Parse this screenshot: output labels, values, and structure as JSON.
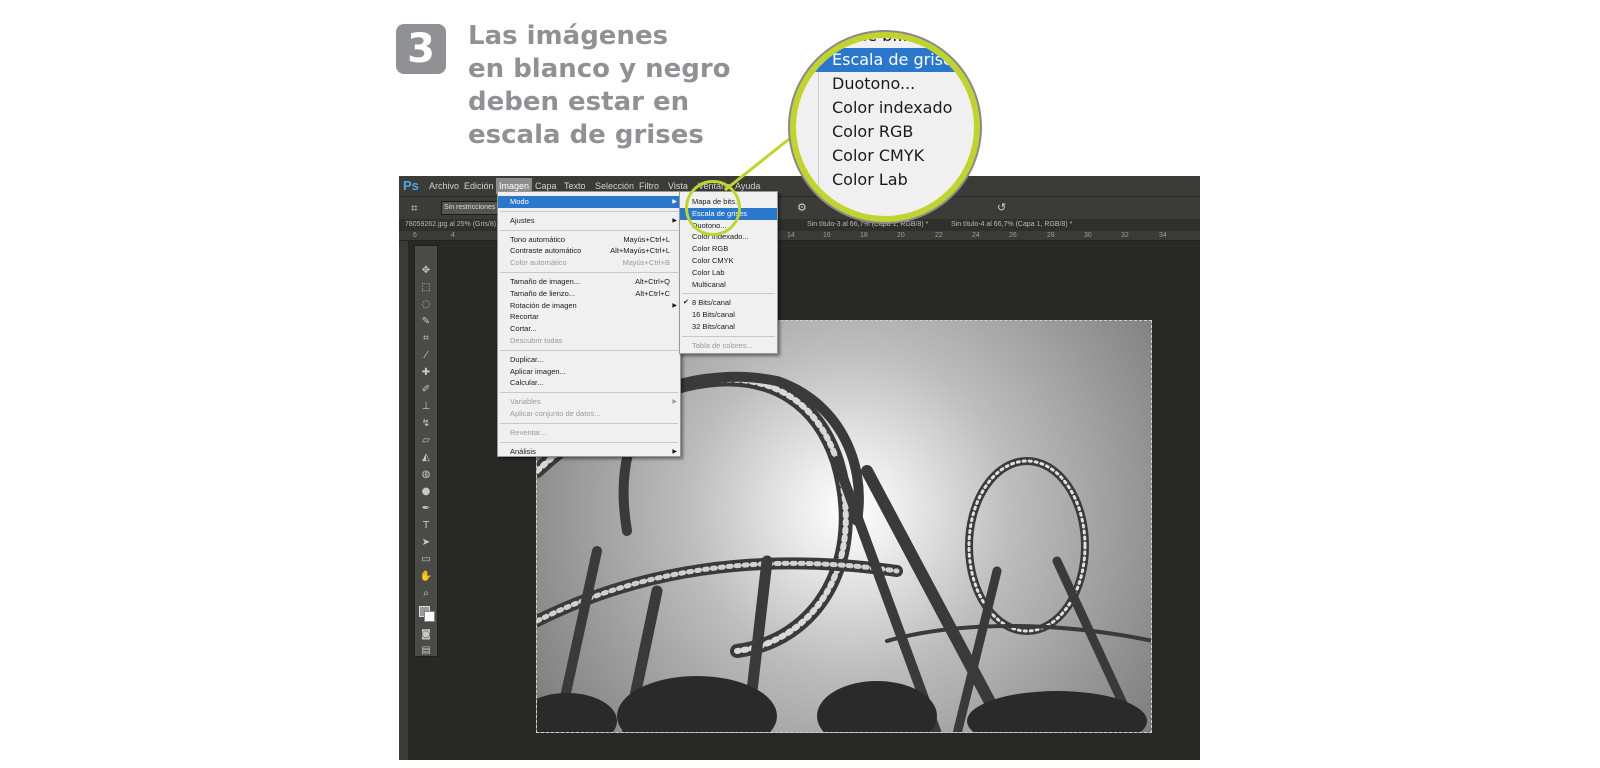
{
  "step": {
    "number": "3",
    "caption_lines": [
      "Las imágenes",
      "en blanco y negro",
      "deben estar en",
      "escala de grises"
    ]
  },
  "app": {
    "logo": "Ps",
    "menubar": [
      "Archivo",
      "Edición",
      "Imagen",
      "Capa",
      "Texto",
      "Selección",
      "Filtro",
      "Vista",
      "Ventana",
      "Ayuda"
    ],
    "active_menu": "Imagen",
    "options_bar": {
      "crop_icon": "crop-icon",
      "ratio_select": "Sin restricciones"
    },
    "tabs": [
      "78059262.jpg al 25% (Gris/8)",
      "Sin título-3 al 66,7% (Capa 1, RGB/8) *",
      "Sin título-4 al 66,7% (Capa 1, RGB/8) *"
    ],
    "tab_close": "×",
    "ruler_ticks": [
      "6",
      "4",
      "14",
      "16",
      "18",
      "20",
      "22",
      "24",
      "26",
      "28",
      "30",
      "32",
      "34"
    ]
  },
  "image_menu": [
    {
      "label": "Modo",
      "submenu": true,
      "highlighted": true
    },
    {
      "separator": true
    },
    {
      "label": "Ajustes",
      "submenu": true
    },
    {
      "separator": true
    },
    {
      "label": "Tono automático",
      "shortcut": "Mayús+Ctrl+L"
    },
    {
      "label": "Contraste automático",
      "shortcut": "Alt+Mayús+Ctrl+L"
    },
    {
      "label": "Color automático",
      "shortcut": "Mayús+Ctrl+B",
      "disabled": true
    },
    {
      "separator": true
    },
    {
      "label": "Tamaño de imagen...",
      "shortcut": "Alt+Ctrl+Q"
    },
    {
      "label": "Tamaño de lienzo...",
      "shortcut": "Alt+Ctrl+C"
    },
    {
      "label": "Rotación de imagen",
      "submenu": true
    },
    {
      "label": "Recortar"
    },
    {
      "label": "Cortar..."
    },
    {
      "label": "Descubrir todas",
      "disabled": true
    },
    {
      "separator": true
    },
    {
      "label": "Duplicar..."
    },
    {
      "label": "Aplicar imagen..."
    },
    {
      "label": "Calcular..."
    },
    {
      "separator": true
    },
    {
      "label": "Variables",
      "submenu": true,
      "disabled": true
    },
    {
      "label": "Aplicar conjunto de datos...",
      "disabled": true
    },
    {
      "separator": true
    },
    {
      "label": "Reventar...",
      "disabled": true
    },
    {
      "separator": true
    },
    {
      "label": "Análisis",
      "submenu": true
    }
  ],
  "mode_submenu": [
    {
      "label": "Mapa de bits..."
    },
    {
      "label": "Escala de grises",
      "highlighted": true
    },
    {
      "label": "Duotono..."
    },
    {
      "label": "Color indexado..."
    },
    {
      "label": "Color RGB"
    },
    {
      "label": "Color CMYK"
    },
    {
      "label": "Color Lab"
    },
    {
      "label": "Multicanal"
    },
    {
      "separator": true
    },
    {
      "label": "8 Bits/canal",
      "checked": true
    },
    {
      "label": "16 Bits/canal"
    },
    {
      "label": "32 Bits/canal"
    },
    {
      "separator": true
    },
    {
      "label": "Tabla de colores...",
      "disabled": true
    }
  ],
  "magnifier": {
    "rows": [
      {
        "label": "pa de b..."
      },
      {
        "label": "Escala de grises",
        "highlighted": true,
        "checked": true
      },
      {
        "label": "Duotono..."
      },
      {
        "label": "Color indexado"
      },
      {
        "label": "Color RGB"
      },
      {
        "label": "Color CMYK"
      },
      {
        "label": "Color Lab"
      }
    ],
    "ring_color": "#c1d32f",
    "highlight_color": "#2a77cc"
  },
  "colors": {
    "app_background": "#282824",
    "menu_highlight": "#2a77cc",
    "accent_ring": "#c1d32f"
  }
}
